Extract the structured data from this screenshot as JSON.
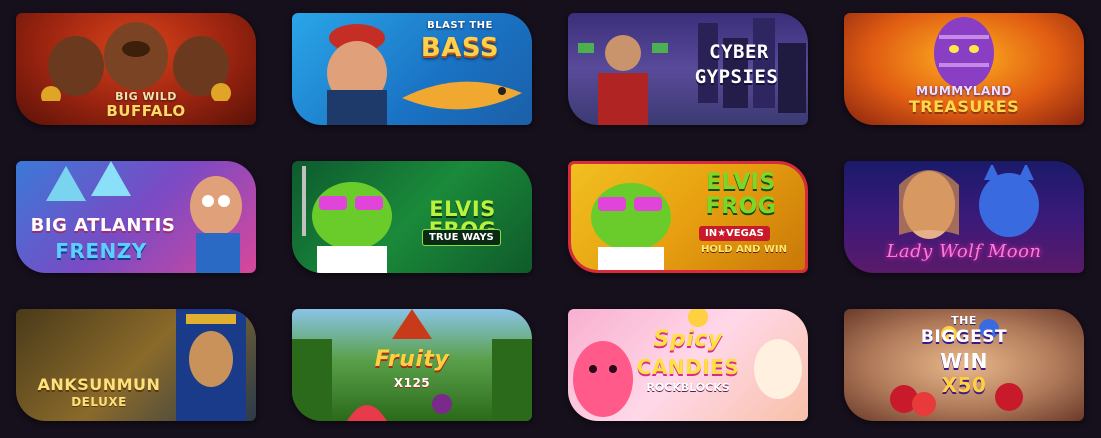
{
  "games": [
    {
      "id": "big-wild-buffalo",
      "line1": "BIG WILD",
      "line2": "BUFFALO"
    },
    {
      "id": "blast-the-bass",
      "line1": "BLAST THE",
      "line2": "BASS"
    },
    {
      "id": "cyber-gypsies",
      "line1": "CYBER",
      "line2": "GYPSIES"
    },
    {
      "id": "mummyland-treasures",
      "line1": "MUMMYLAND",
      "line2": "TREASURES"
    },
    {
      "id": "big-atlantis-frenzy",
      "line1": "BIG ATLANTIS",
      "line2": "FRENZY"
    },
    {
      "id": "elvis-frog-trueways",
      "line1": "ELVIS FROG",
      "line2": "TRUE WAYS"
    },
    {
      "id": "elvis-frog-in-vegas",
      "line1": "ELVIS",
      "line2": "FROG",
      "line3": "IN★VEGAS",
      "line4": "HOLD AND WIN"
    },
    {
      "id": "lady-wolf-moon",
      "line1": "Lady Wolf Moon"
    },
    {
      "id": "anksunmun-deluxe",
      "line1": "ANKSUNMUN",
      "line2": "DELUXE"
    },
    {
      "id": "fruity-x125",
      "line1": "Fruity",
      "line2": "X125"
    },
    {
      "id": "spicy-candies-rockblocks",
      "line1": "Spicy",
      "line2": "CANDIES",
      "line3": "ROCKBLOCKS"
    },
    {
      "id": "the-biggest-win-x50",
      "line1": "THE",
      "line2": "BIGGEST",
      "line3": "WIN",
      "line4": "X50"
    }
  ]
}
